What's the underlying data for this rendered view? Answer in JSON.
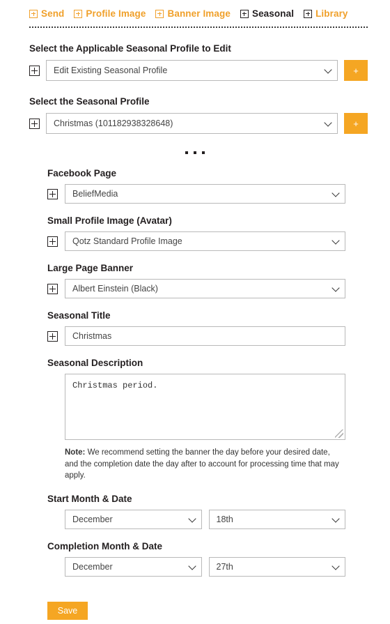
{
  "nav": {
    "items": [
      {
        "label": "Send",
        "icon": "plus-box-icon",
        "active": false
      },
      {
        "label": "Profile Image",
        "icon": "plus-box-icon",
        "active": false
      },
      {
        "label": "Banner Image",
        "icon": "plus-box-icon",
        "active": false
      },
      {
        "label": "Seasonal",
        "icon": "plus-box-icon",
        "active": true
      },
      {
        "label": "Library",
        "icon": "plus-box-icon",
        "active": false
      }
    ]
  },
  "colors": {
    "accent_orange": "#f0a02a",
    "button_orange": "#f5a623",
    "text_dark": "#231f20",
    "border_grey": "#b9b9b9"
  },
  "sections": {
    "profile_to_edit": {
      "label": "Select the Applicable Seasonal Profile to Edit",
      "value": "Edit Existing Seasonal Profile",
      "add_label": "+"
    },
    "seasonal_profile": {
      "label": "Select the Seasonal Profile",
      "value": "Christmas (101182938328648)",
      "add_label": "+"
    },
    "facebook_page": {
      "label": "Facebook Page",
      "value": "BeliefMedia"
    },
    "avatar": {
      "label": "Small Profile Image (Avatar)",
      "value": "Qotz Standard Profile Image"
    },
    "banner": {
      "label": "Large Page Banner",
      "value": "Albert Einstein (Black)"
    },
    "seasonal_title": {
      "label": "Seasonal Title",
      "value": "Christmas"
    },
    "seasonal_description": {
      "label": "Seasonal Description",
      "value": "Christmas period."
    },
    "note": {
      "prefix": "Note:",
      "text": " We recommend setting the banner the day before your desired date, and the completion date the day after to account for processing time that may apply."
    },
    "start_date": {
      "label": "Start Month & Date",
      "month": "December",
      "day": "18th"
    },
    "completion_date": {
      "label": "Completion Month & Date",
      "month": "December",
      "day": "27th"
    }
  },
  "footer": {
    "save_label": "Save"
  }
}
